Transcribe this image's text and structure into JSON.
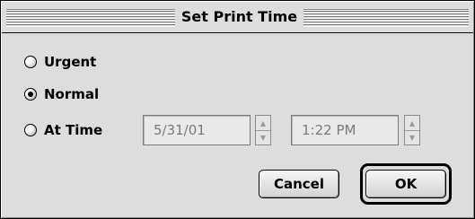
{
  "dialog": {
    "title": "Set Print Time"
  },
  "options": {
    "urgent_label": "Urgent",
    "normal_label": "Normal",
    "at_time_label": "At Time",
    "selected": "Normal"
  },
  "date_field": {
    "value": "5/31/01"
  },
  "time_field": {
    "value": "1:22 PM"
  },
  "buttons": {
    "cancel_label": "Cancel",
    "ok_label": "OK"
  },
  "colors": {
    "window_bg": "#dddddd",
    "field_text_disabled": "#7a7a7a"
  }
}
